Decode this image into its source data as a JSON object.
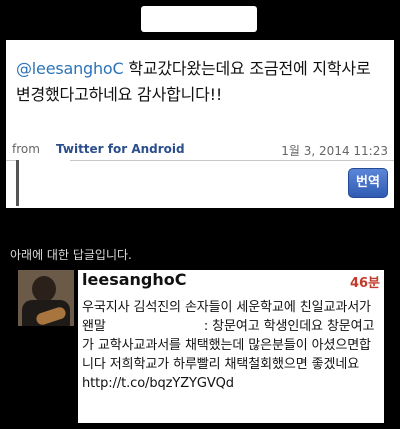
{
  "tweet": {
    "mention": "@leesanghoC",
    "text": " 학교갔다왔는데요 조금전에 지학사로 변경했다고하네요 감사합니다!!",
    "from_label": "from",
    "source": "Twitter for Android",
    "timestamp": "1월 3, 2014 11:23",
    "translate_label": "번역"
  },
  "reply": {
    "header": "아래에 대한 답글입니다.",
    "username": "leesanghoC",
    "age": "46분",
    "text_part1": "우국지사 김석진의 손자들이 세운학교에 친일교과서가 왠말",
    "text_part2": ": 창문여고 학생인데요 창문여고가 교학사교과서를 채택했는데 많은분들이 아셨으면합니다 저희학교가 하루빨리 채택철회했으면 좋겠네요 http://t.co/bqzYZYGVQd"
  },
  "icons": {
    "avatar": "user-avatar-photo"
  }
}
